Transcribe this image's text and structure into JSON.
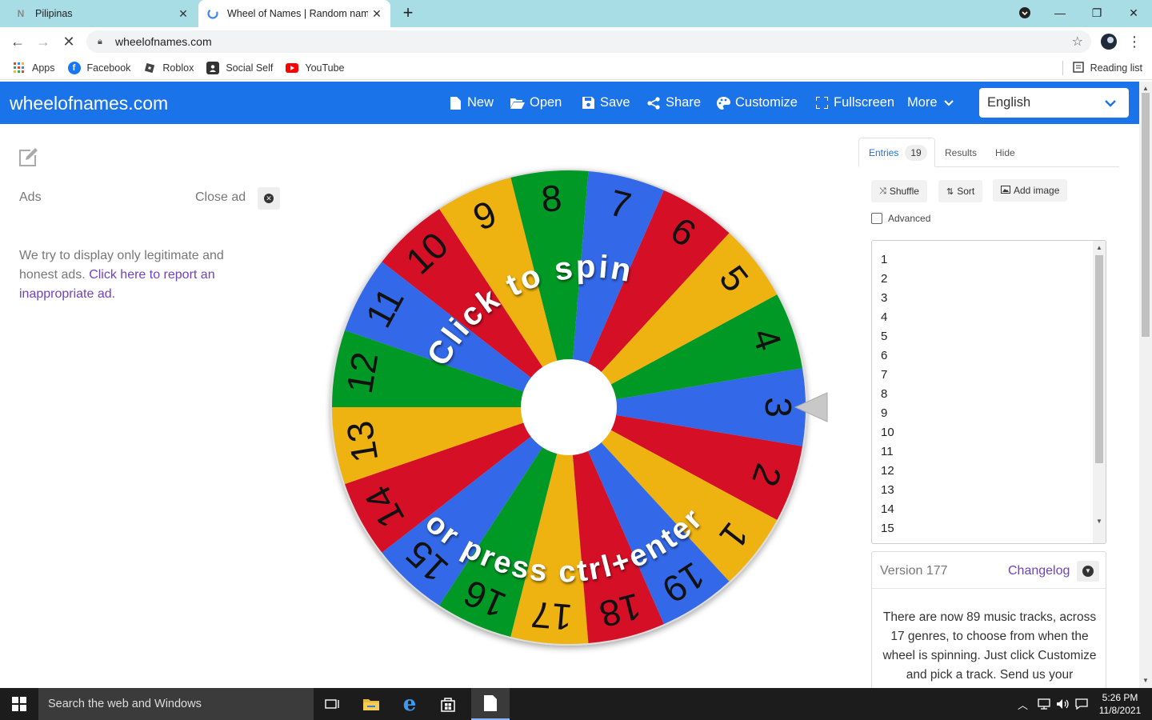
{
  "browser": {
    "tabs": [
      {
        "title": "Pilipinas",
        "favicon": "N",
        "active": false
      },
      {
        "title": "Wheel of Names | Random name",
        "favicon": "G",
        "active": true
      }
    ],
    "url": "wheelofnames.com",
    "bookmarks": [
      {
        "label": "Apps",
        "icon": "apps-grid-icon"
      },
      {
        "label": "Facebook",
        "icon": "facebook-icon"
      },
      {
        "label": "Roblox",
        "icon": "roblox-icon"
      },
      {
        "label": "Social Self",
        "icon": "social-self-icon"
      },
      {
        "label": "YouTube",
        "icon": "youtube-icon"
      }
    ],
    "reading_list": "Reading list"
  },
  "site": {
    "brand": "wheelofnames.com",
    "nav": {
      "new": "New",
      "open": "Open",
      "save": "Save",
      "share": "Share",
      "customize": "Customize",
      "fullscreen": "Fullscreen",
      "more": "More"
    },
    "language": "English"
  },
  "ads": {
    "label": "Ads",
    "close_label": "Close ad",
    "text": "We try to display only legitimate and honest ads.",
    "report_link": "Click here to report an inappropriate ad."
  },
  "wheel": {
    "top_text": "Click to spin",
    "bottom_text": "or press ctrl+enter",
    "segment_colors": [
      "#eeb211",
      "#d50f25",
      "#3369e8",
      "#009925"
    ],
    "center_color": "#ffffff"
  },
  "panel": {
    "tabs": {
      "entries": "Entries",
      "entries_count": "19",
      "results": "Results",
      "hide": "Hide"
    },
    "buttons": {
      "shuffle": "Shuffle",
      "sort": "Sort",
      "add_image": "Add image"
    },
    "advanced": "Advanced",
    "entries": [
      "1",
      "2",
      "3",
      "4",
      "5",
      "6",
      "7",
      "8",
      "9",
      "10",
      "11",
      "12",
      "13",
      "14",
      "15"
    ],
    "version": {
      "label": "Version 177",
      "changelog": "Changelog",
      "text": "There are now 89 music tracks, across 17 genres, to choose from when the wheel is spinning. Just click Customize and pick a track. Send us your"
    }
  },
  "taskbar": {
    "search_placeholder": "Search the web and Windows",
    "time": "5:26 PM",
    "date": "11/8/2021"
  }
}
